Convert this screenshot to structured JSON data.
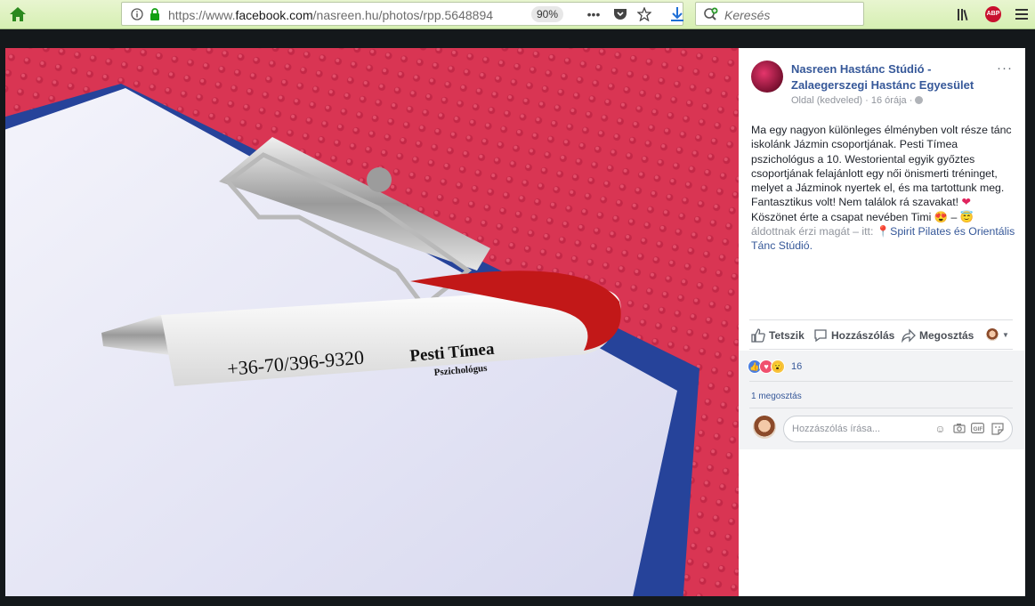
{
  "browser": {
    "url_prefix": "https://www.",
    "url_domain": "facebook.com",
    "url_path": "/nasreen.hu/photos/rpp.5648894",
    "zoom": "90%",
    "search_placeholder": "Keresés",
    "abp_badge": "ABP"
  },
  "post": {
    "page_name": "Nasreen Hastánc Stúdió - Zalaegerszegi Hastánc Egyesület",
    "meta_type": "Oldal (kedveled)",
    "meta_sep": "·",
    "meta_time": "16 órája",
    "meta_sep2": "·",
    "more": "···",
    "text_main": "Ma egy nagyon különleges élményben volt része tánc iskolánk Jázmin csoportjának. Pesti Tímea pszichológus a 10. Westoriental egyik győztes csoportjának felajánlott egy női önismerti tréninget, melyet a Jázminok nyertek el, és ma tartottunk meg. Fantasztikus volt! Nem találok rá szavakat!",
    "text_heart": "❤",
    "text_thanks": "Köszönet érte a csapat nevében Timi",
    "text_emoji1": "😍",
    "text_dash": " – ",
    "text_emoji2": "😇",
    "text_feeling": " áldottnak érzi magát – itt: ",
    "location_icon": "pin-icon",
    "location_link": "Spirit Pilates és Orientális Tánc Stúdió",
    "text_end": "."
  },
  "actions": {
    "like": "Tetszik",
    "comment": "Hozzászólás",
    "share": "Megosztás"
  },
  "reactions": {
    "count": "16",
    "colors": {
      "like": "#4a7ee0",
      "love": "#f0506e",
      "wow": "#f7c43e"
    }
  },
  "shares_text": "1 megosztás",
  "comment_input": {
    "placeholder": "Hozzászólás írása..."
  },
  "photo": {
    "pen_phone": "+36-70/396-9320",
    "pen_name": "Pesti Tímea",
    "pen_title": "Pszichológus"
  }
}
